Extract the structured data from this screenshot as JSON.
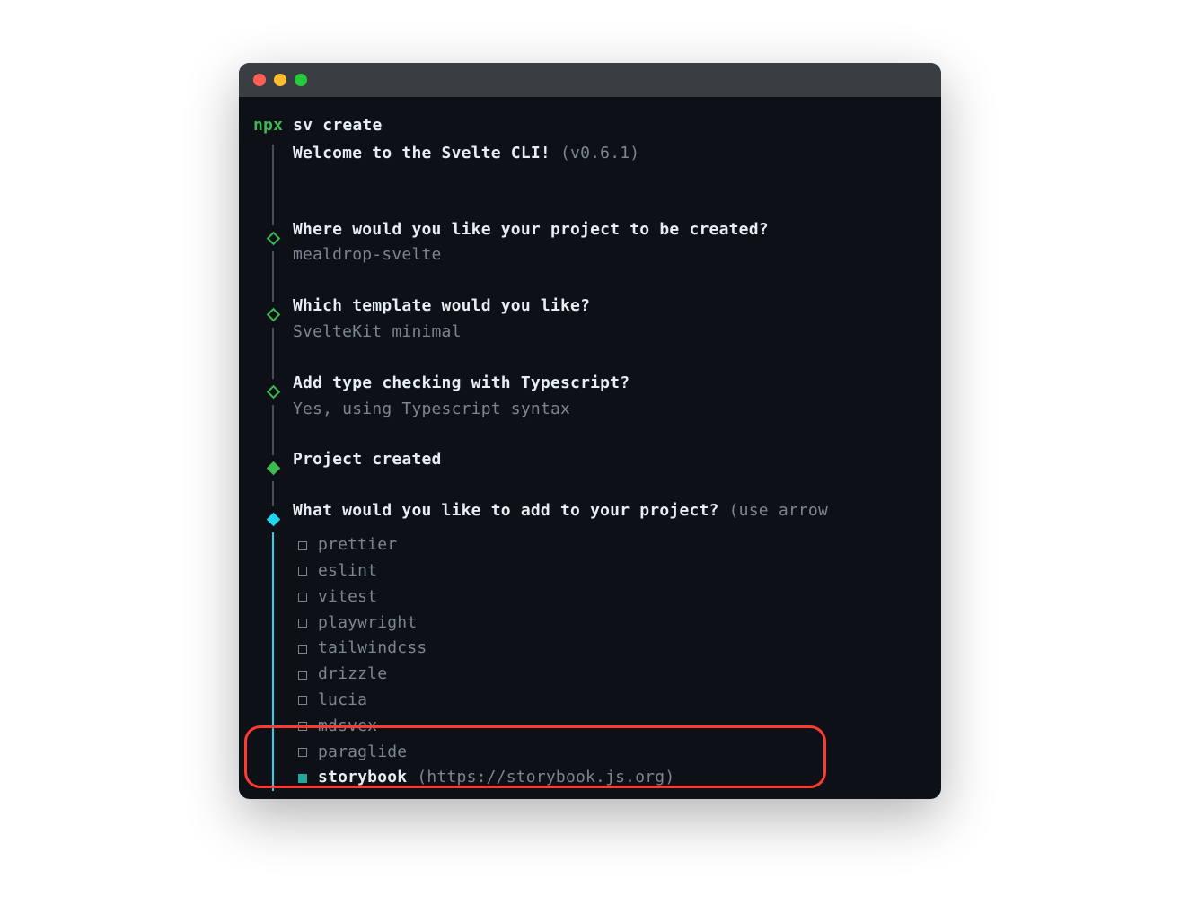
{
  "command": {
    "npx": "npx",
    "cmd": "sv create"
  },
  "welcome": {
    "text": "Welcome to the Svelte CLI!",
    "version": "(v0.6.1)"
  },
  "steps": [
    {
      "question": "Where would you like your project to be created?",
      "answer": "mealdrop-svelte"
    },
    {
      "question": "Which template would you like?",
      "answer": "SvelteKit minimal"
    },
    {
      "question": "Add type checking with Typescript?",
      "answer": "Yes, using Typescript syntax"
    }
  ],
  "created": "Project created",
  "currentQuestion": {
    "text": "What would you like to add to your project?",
    "hint": "(use arrow"
  },
  "options": [
    {
      "label": "prettier",
      "selected": false
    },
    {
      "label": "eslint",
      "selected": false
    },
    {
      "label": "vitest",
      "selected": false
    },
    {
      "label": "playwright",
      "selected": false
    },
    {
      "label": "tailwindcss",
      "selected": false
    },
    {
      "label": "drizzle",
      "selected": false
    },
    {
      "label": "lucia",
      "selected": false
    },
    {
      "label": "mdsvex",
      "selected": false
    },
    {
      "label": "paraglide",
      "selected": false
    },
    {
      "label": "storybook",
      "selected": true,
      "url": "(https://storybook.js.org)"
    }
  ]
}
